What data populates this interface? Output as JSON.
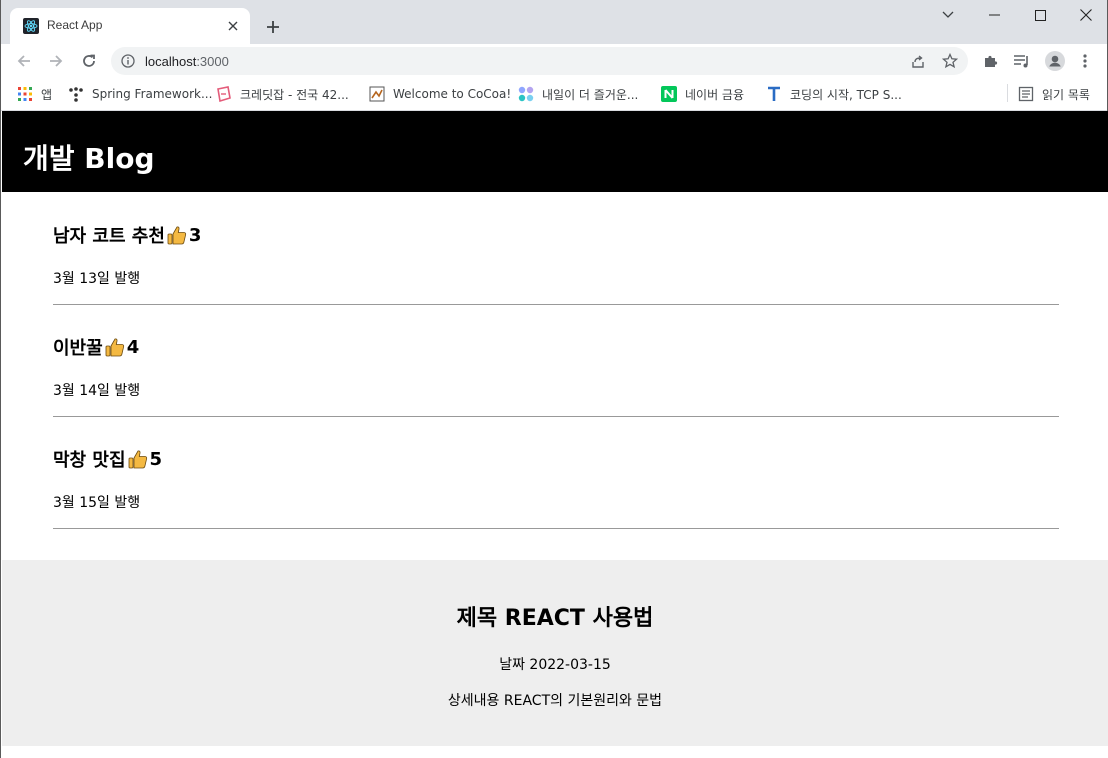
{
  "browser": {
    "tab": {
      "title": "React App"
    },
    "address_bar": {
      "host": "localhost",
      "port": ":3000"
    },
    "bookmarks": [
      {
        "label": "앱",
        "icon": "apps-grid-icon"
      },
      {
        "label": "Spring Framework...",
        "icon": "spring-icon"
      },
      {
        "label": "크레딧잡 - 전국 42...",
        "icon": "creditjob-icon"
      },
      {
        "label": "Welcome to CoCoa!",
        "icon": "cocoa-icon"
      },
      {
        "label": "내일이 더 즐거운...",
        "icon": "dots-icon"
      },
      {
        "label": "네이버 금융",
        "icon": "naver-icon"
      },
      {
        "label": "코딩의 시작, TCP S...",
        "icon": "tcp-school-icon"
      }
    ],
    "reading_list": {
      "label": "읽기 목록"
    }
  },
  "nav": {
    "title": "개발 Blog"
  },
  "posts": [
    {
      "title": "남자 코트 추천",
      "likes": "3",
      "date": "3월 13일 발행"
    },
    {
      "title": "이반꿀",
      "likes": "4",
      "date": "3월 14일 발행"
    },
    {
      "title": "막창 맛집",
      "likes": "5",
      "date": "3월 15일 발행"
    }
  ],
  "modal": {
    "title": "제목 REACT 사용법",
    "date": "날짜 2022-03-15",
    "content": "상세내용 REACT의 기본원리와 문법"
  },
  "colors": {
    "nav_bg": "#000000",
    "modal_bg": "#eeeeee",
    "divider": "#999999"
  }
}
